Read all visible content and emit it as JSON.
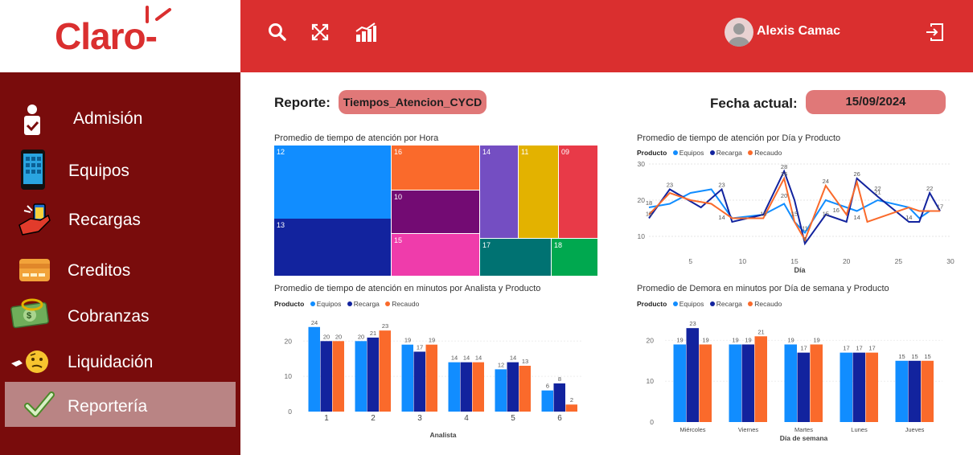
{
  "brand": {
    "logo_text": "Claro-",
    "accent": "#da2f2f",
    "sidebar_bg": "#790c0c",
    "active_bg": "#b98484"
  },
  "topbar": {
    "icons": [
      "search-icon",
      "expand-arrows-icon",
      "bar-chart-up-icon"
    ],
    "user_name": "Alexis Camac",
    "logout_icon": "logout-icon"
  },
  "sidebar": {
    "items": [
      {
        "label": "Admisión",
        "icon": "clipboard-person-icon"
      },
      {
        "label": "Equipos",
        "icon": "phone-grid-icon"
      },
      {
        "label": "Recargas",
        "icon": "hand-phone-icon"
      },
      {
        "label": "Creditos",
        "icon": "credit-card-icon"
      },
      {
        "label": "Cobranzas",
        "icon": "money-bill-icon"
      },
      {
        "label": "Liquidación",
        "icon": "thinking-face-icon"
      },
      {
        "label": "Reportería",
        "icon": "check-mark-icon",
        "active": true
      }
    ]
  },
  "header": {
    "report_label": "Reporte:",
    "report_value": "Tiempos_Atencion_CYCD",
    "date_label": "Fecha actual:",
    "date_value": "15/09/2024"
  },
  "legend_title": "Producto",
  "legend_items": [
    "Equipos",
    "Recarga",
    "Recaudo"
  ],
  "series_colors": [
    "#118dff",
    "#12239e",
    "#fa6a2b"
  ],
  "chart_data": [
    {
      "type": "treemap",
      "title": "Promedio de tiempo de atención por Hora",
      "categories": [
        "12",
        "13",
        "16",
        "10",
        "15",
        "14",
        "17",
        "11",
        "09",
        "18"
      ],
      "colors": [
        "#118dff",
        "#12239e",
        "#fa6a2b",
        "#730b73",
        "#ef3cab",
        "#744ec2",
        "#007272",
        "#e3b200",
        "#e83a48",
        "#00a84f"
      ]
    },
    {
      "type": "line",
      "title": "Promedio de tiempo de atención por Día y Producto",
      "xlabel": "Día",
      "xlim": [
        1,
        30
      ],
      "ylim": [
        6,
        30
      ],
      "xticks": [
        5,
        10,
        15,
        20,
        25,
        30
      ],
      "yticks": [
        10,
        20,
        30
      ],
      "series": [
        {
          "name": "Equipos",
          "x": [
            1,
            3,
            5,
            7,
            9,
            12,
            14,
            15,
            16,
            18,
            20,
            21,
            23,
            26,
            27,
            28,
            29
          ],
          "y": [
            18,
            19,
            22,
            23,
            15,
            16,
            19,
            14,
            11,
            20,
            18,
            17,
            20,
            18,
            15,
            17,
            17
          ]
        },
        {
          "name": "Recarga",
          "x": [
            1,
            3,
            6,
            8,
            9,
            12,
            14,
            15,
            16,
            18,
            20,
            21,
            23,
            26,
            27,
            28,
            29
          ],
          "y": [
            15,
            23,
            18,
            23,
            14,
            16,
            28,
            20,
            8,
            16,
            14,
            26,
            21,
            14,
            14,
            22,
            17
          ]
        },
        {
          "name": "Recaudo",
          "x": [
            1,
            3,
            5,
            7,
            9,
            12,
            14,
            15,
            16,
            18,
            20,
            21,
            22,
            26,
            27,
            28,
            29
          ],
          "y": [
            16,
            22,
            20,
            19,
            15,
            15,
            26,
            14,
            9,
            24,
            16,
            25,
            14,
            18,
            17,
            17,
            17
          ]
        }
      ],
      "data_labels": [
        {
          "x": 1,
          "y": 15,
          "text": "15"
        },
        {
          "x": 1,
          "y": 18,
          "text": "18"
        },
        {
          "x": 3,
          "y": 23,
          "text": "23"
        },
        {
          "x": 8,
          "y": 23,
          "text": "23"
        },
        {
          "x": 8,
          "y": 14,
          "text": "14"
        },
        {
          "x": 12,
          "y": 15,
          "text": "15"
        },
        {
          "x": 14,
          "y": 28,
          "text": "28"
        },
        {
          "x": 14,
          "y": 26,
          "text": "26"
        },
        {
          "x": 14,
          "y": 20,
          "text": "20"
        },
        {
          "x": 15,
          "y": 15,
          "text": "15"
        },
        {
          "x": 16,
          "y": 8,
          "text": "8"
        },
        {
          "x": 16,
          "y": 11,
          "text": "11"
        },
        {
          "x": 18,
          "y": 24,
          "text": "24"
        },
        {
          "x": 18,
          "y": 15,
          "text": "15"
        },
        {
          "x": 19,
          "y": 16,
          "text": "16"
        },
        {
          "x": 21,
          "y": 26,
          "text": "26"
        },
        {
          "x": 21,
          "y": 14,
          "text": "14"
        },
        {
          "x": 23,
          "y": 22,
          "text": "22"
        },
        {
          "x": 23,
          "y": 21,
          "text": "21"
        },
        {
          "x": 26,
          "y": 14,
          "text": "14"
        },
        {
          "x": 28,
          "y": 22,
          "text": "22"
        },
        {
          "x": 29,
          "y": 17,
          "text": "17"
        }
      ]
    },
    {
      "type": "bar",
      "title": "Promedio de tiempo de atención en minutos por Analista y Producto",
      "xlabel": "Analista",
      "categories": [
        "1",
        "2",
        "3",
        "4",
        "5",
        "6"
      ],
      "ylim": [
        0,
        26
      ],
      "yticks": [
        0,
        10,
        20
      ],
      "series": [
        {
          "name": "Equipos",
          "values": [
            24,
            20,
            19,
            14,
            12,
            6
          ]
        },
        {
          "name": "Recarga",
          "values": [
            20,
            21,
            17,
            14,
            14,
            8
          ]
        },
        {
          "name": "Recaudo",
          "values": [
            20,
            23,
            19,
            14,
            13,
            2
          ]
        }
      ]
    },
    {
      "type": "bar",
      "title": "Promedio de Demora en minutos por Día de semana y Producto",
      "xlabel": "Día de semana",
      "categories": [
        "Miércoles",
        "Viernes",
        "Martes",
        "Lunes",
        "Jueves"
      ],
      "ylim": [
        0,
        25
      ],
      "yticks": [
        0,
        10,
        20
      ],
      "series": [
        {
          "name": "Equipos",
          "values": [
            19,
            19,
            19,
            17,
            15
          ]
        },
        {
          "name": "Recarga",
          "values": [
            23,
            19,
            17,
            17,
            15
          ]
        },
        {
          "name": "Recaudo",
          "values": [
            19,
            21,
            19,
            17,
            15
          ]
        }
      ]
    }
  ]
}
